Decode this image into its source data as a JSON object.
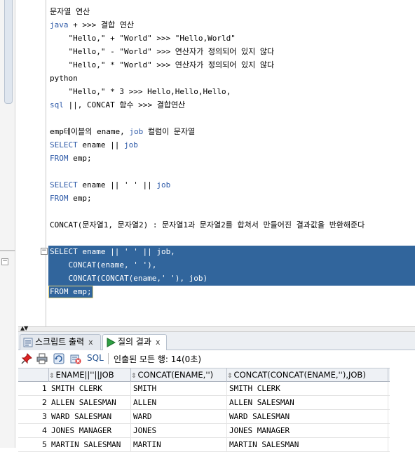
{
  "editor": {
    "lines": [
      [
        {
          "t": "문자열 연산",
          "c": ""
        }
      ],
      [
        {
          "t": "java",
          "c": "kw"
        },
        {
          "t": " + >>> 결합 연산",
          "c": ""
        }
      ],
      [
        {
          "t": "    \"Hello,\" + \"World\" >>> \"Hello,World\"",
          "c": ""
        }
      ],
      [
        {
          "t": "    \"Hello,\" - \"World\" >>> 연산자가 정의되어 있지 않다",
          "c": ""
        }
      ],
      [
        {
          "t": "    \"Hello,\" * \"World\" >>> 연산자가 정의되어 있지 않다",
          "c": ""
        }
      ],
      [
        {
          "t": "python",
          "c": ""
        }
      ],
      [
        {
          "t": "    \"Hello,\" * 3 >>> Hello,Hello,Hello,",
          "c": ""
        }
      ],
      [
        {
          "t": "sql",
          "c": "kw"
        },
        {
          "t": " ||, CONCAT 함수 >>> 결합연산",
          "c": ""
        }
      ],
      [
        {
          "t": "",
          "c": ""
        }
      ],
      [
        {
          "t": "emp테이블의 ename, ",
          "c": ""
        },
        {
          "t": "job",
          "c": "kw"
        },
        {
          "t": " 컬럼이 문자열",
          "c": ""
        }
      ],
      [
        {
          "t": "SELECT",
          "c": "kw"
        },
        {
          "t": " ename || ",
          "c": ""
        },
        {
          "t": "job",
          "c": "kw"
        }
      ],
      [
        {
          "t": "FROM",
          "c": "kw"
        },
        {
          "t": " emp;",
          "c": ""
        }
      ],
      [
        {
          "t": "",
          "c": ""
        }
      ],
      [
        {
          "t": "SELECT",
          "c": "kw"
        },
        {
          "t": " ename || ' ' || ",
          "c": ""
        },
        {
          "t": "job",
          "c": "kw"
        }
      ],
      [
        {
          "t": "FROM",
          "c": "kw"
        },
        {
          "t": " emp;",
          "c": ""
        }
      ],
      [
        {
          "t": "",
          "c": ""
        }
      ],
      [
        {
          "t": "CONCAT(문자열1, 문자열2) : 문자열1과 문자열2를 합쳐서 만들어진 결과값을 반환해준다",
          "c": ""
        }
      ],
      [
        {
          "t": "",
          "c": ""
        }
      ],
      [
        {
          "t": "SELECT ename || ' ' || job,",
          "c": "sel"
        }
      ],
      [
        {
          "t": "    CONCAT(ename, ' '),",
          "c": "sel"
        }
      ],
      [
        {
          "t": "    CONCAT(CONCAT(ename,' '), job)",
          "c": "sel"
        }
      ],
      [
        {
          "t": "FROM emp;",
          "c": "sel"
        }
      ]
    ]
  },
  "tabs": [
    {
      "label": "스크립트 출력",
      "close": "x",
      "icon": "script-output-icon"
    },
    {
      "label": "질의 결과",
      "close": "x",
      "icon": "run-query-icon"
    }
  ],
  "toolbar": {
    "sql_label": "SQL",
    "status": "인출된 모든 행: 14(0초)",
    "icons": [
      "pin-icon",
      "print-icon",
      "refresh-icon",
      "delete-icon"
    ]
  },
  "grid": {
    "columns": [
      "ENAME||''||JOB",
      "CONCAT(ENAME,'')",
      "CONCAT(CONCAT(ENAME,''),JOB)"
    ],
    "rows": [
      {
        "n": "1",
        "c": [
          "SMITH CLERK",
          "SMITH",
          "SMITH CLERK"
        ]
      },
      {
        "n": "2",
        "c": [
          "ALLEN SALESMAN",
          "ALLEN",
          "ALLEN SALESMAN"
        ]
      },
      {
        "n": "3",
        "c": [
          "WARD SALESMAN",
          "WARD",
          "WARD SALESMAN"
        ]
      },
      {
        "n": "4",
        "c": [
          "JONES MANAGER",
          "JONES",
          "JONES MANAGER"
        ]
      },
      {
        "n": "5",
        "c": [
          "MARTIN SALESMAN",
          "MARTIN",
          "MARTIN SALESMAN"
        ]
      }
    ]
  },
  "colors": {
    "keyword": "#2e5aa8",
    "selection": "#31659c"
  }
}
